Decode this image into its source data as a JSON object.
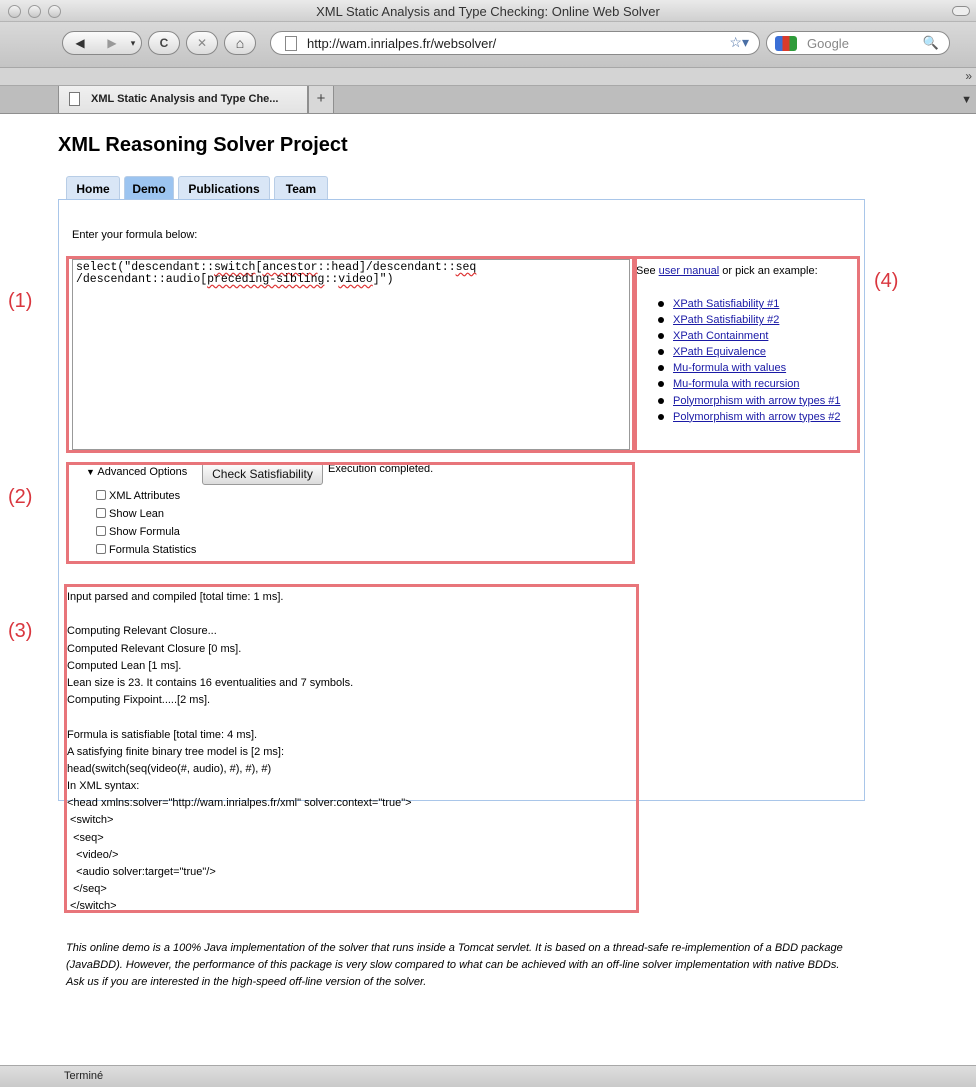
{
  "window": {
    "title": "XML Static Analysis and Type Checking: Online Web Solver"
  },
  "toolbar": {
    "url": "http://wam.inrialpes.fr/websolver/",
    "search_placeholder": "Google",
    "back_icon": "◀",
    "forward_icon": "▶",
    "reload_icon": "C",
    "stop_icon": "✕",
    "home_icon": "⌂",
    "star_icon": "☆▾",
    "search_icon": "🔍"
  },
  "bookmarks": {
    "overflow": "»"
  },
  "tabs": {
    "active_title": "XML Static Analysis and Type Che...",
    "new_tab": "+"
  },
  "page": {
    "title": "XML Reasoning Solver Project",
    "nav": [
      "Home",
      "Demo",
      "Publications",
      "Team"
    ],
    "active_nav": "Demo"
  },
  "form": {
    "prompt": "Enter your formula below:",
    "formula_line1_a": "select(\"descendant::",
    "formula_line1_b": "switch",
    "formula_line1_c": "[",
    "formula_line1_d": "ancestor",
    "formula_line1_e": "::head]/descendant::",
    "formula_line1_f": "seq",
    "formula_line2_a": "/descendant::audio[",
    "formula_line2_b": "preceding-sibling",
    "formula_line2_c": "::",
    "formula_line2_d": "video",
    "formula_line2_e": "]\")",
    "advanced_label": "Advanced Options",
    "advanced_icon": "▼",
    "check_button": "Check Satisfiability",
    "status": "Execution completed.",
    "options": [
      "XML Attributes",
      "Show Lean",
      "Show Formula",
      "Formula Statistics"
    ]
  },
  "examples": {
    "see": "See",
    "manual_link": "user manual",
    "pick": "or pick an example:",
    "items": [
      "XPath Satisfiability #1",
      "XPath Satisfiability #2",
      "XPath Containment",
      "XPath Equivalence",
      "Mu-formula with values",
      "Mu-formula with recursion",
      "Polymorphism with arrow types #1",
      "Polymorphism with arrow types #2"
    ]
  },
  "output": {
    "lines": [
      "Input parsed and compiled [total time: 1 ms].",
      "",
      "Computing Relevant Closure...",
      "Computed Relevant Closure [0 ms].",
      "Computed Lean [1 ms].",
      "Lean size is 23. It contains 16 eventualities and 7 symbols.",
      "Computing Fixpoint.....[2 ms].",
      "",
      "Formula is satisfiable [total time: 4 ms].",
      "A satisfying finite binary tree model is [2 ms]:",
      "head(switch(seq(video(#, audio), #), #), #)",
      "In XML syntax:",
      "<head xmlns:solver=\"http://wam.inrialpes.fr/xml\" solver:context=\"true\">",
      " <switch>",
      "  <seq>",
      "   <video/>",
      "   <audio solver:target=\"true\"/>",
      "  </seq>",
      " </switch>",
      "</head>"
    ]
  },
  "footer": {
    "note": "This online demo is a 100% Java implementation of the solver that runs inside a Tomcat servlet. It is based on a thread-safe re-implemention of a BDD package (JavaBDD). However, the performance of this package is very slow compared to what can be achieved with an off-line solver implementation with native BDDs. Ask us if you are interested in the high-speed off-line version of the solver."
  },
  "annotations": [
    "(1)",
    "(2)",
    "(3)",
    "(4)"
  ],
  "statusbar": {
    "text": "Terminé"
  },
  "colors": {
    "annotation_red": "#e8757a",
    "active_tab": "#9cc4f0",
    "tab": "#d9e6f6",
    "panel_border": "#a9c6e9"
  }
}
